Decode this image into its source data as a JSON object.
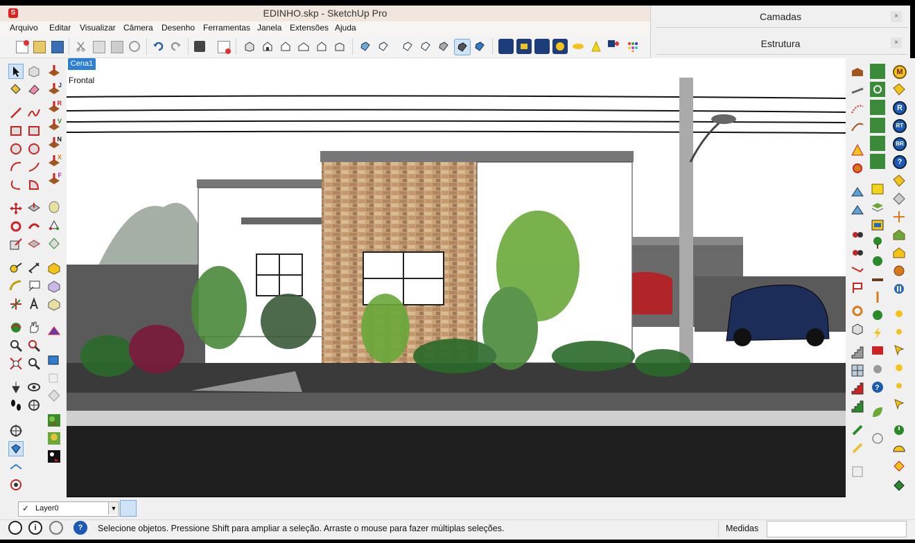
{
  "window": {
    "title": "EDINHO.skp - SketchUp Pro"
  },
  "menu": [
    "Arquivo",
    "Editar",
    "Visualizar",
    "Câmera",
    "Desenho",
    "Ferramentas",
    "Janela",
    "Extensões",
    "Ajuda"
  ],
  "panels": {
    "layers_title": "Camadas",
    "outliner_title": "Estrutura",
    "close_glyph": "×"
  },
  "scene": {
    "tab_label": "Cena1",
    "view_label": "Frontal"
  },
  "layer": {
    "current": "Layer0"
  },
  "status": {
    "message": "Selecione objetos. Pressione Shift para ampliar a seleção. Arraste o mouse para fazer múltiplas seleções.",
    "measures_label": "Medidas",
    "measures_value": ""
  },
  "ruby_toolbar_letters": [
    "J",
    "R",
    "V",
    "N",
    "X",
    "F"
  ],
  "right_toolbar_letters": [
    "M",
    "R",
    "RT",
    "BR",
    "?"
  ],
  "colors": {
    "accent": "#2d7fd3",
    "title_bg": "#f0e6de",
    "toolbar_bg": "#f0f0f0",
    "viewport_bg": "#ffffff"
  }
}
